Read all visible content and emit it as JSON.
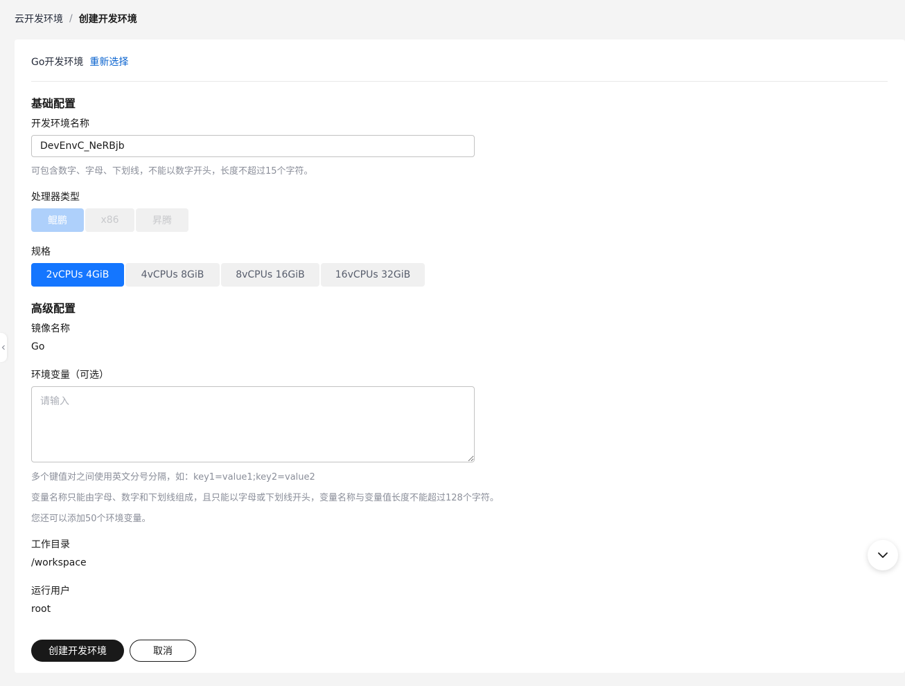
{
  "breadcrumb": {
    "parent": "云开发环境",
    "separator": "/",
    "current": "创建开发环境"
  },
  "env_head": {
    "type": "Go开发环境",
    "reselect": "重新选择"
  },
  "basic": {
    "title": "基础配置",
    "name_label": "开发环境名称",
    "name_value": "DevEnvC_NeRBjb",
    "name_hint": "可包含数字、字母、下划线，不能以数字开头，长度不超过15个字符。",
    "cpu_label": "处理器类型",
    "cpu_options": [
      "鲲鹏",
      "x86",
      "昇腾"
    ],
    "spec_label": "规格",
    "spec_options": [
      "2vCPUs 4GiB",
      "4vCPUs 8GiB",
      "8vCPUs 16GiB",
      "16vCPUs 32GiB"
    ]
  },
  "advanced": {
    "title": "高级配置",
    "image_label": "镜像名称",
    "image_value": "Go",
    "env_label": "环境变量（可选）",
    "env_placeholder": "请输入",
    "env_hint1": "多个键值对之间使用英文分号分隔，如：key1=value1;key2=value2",
    "env_hint2": "变量名称只能由字母、数字和下划线组成，且只能以字母或下划线开头，变量名称与变量值长度不能超过128个字符。",
    "env_hint3": "您还可以添加50个环境变量。",
    "workdir_label": "工作目录",
    "workdir_value": "/workspace",
    "user_label": "运行用户",
    "user_value": "root"
  },
  "actions": {
    "create": "创建开发环境",
    "cancel": "取消"
  },
  "icons": {
    "side_toggle": "chevron-left-icon",
    "scroll_fab": "chevron-down-icon"
  },
  "colors": {
    "accent": "#1476ff",
    "link": "#0a63cf",
    "primary_button": "#191919"
  }
}
